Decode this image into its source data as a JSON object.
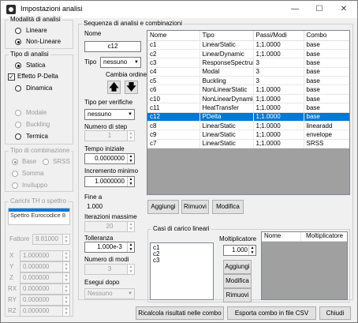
{
  "window": {
    "title": "Impostazioni analisi",
    "minimize": "—",
    "maximize": "☐",
    "close": "✕"
  },
  "modalita": {
    "title": "Modalità di analisi",
    "options": [
      "Lineare",
      "Non-Lineare"
    ]
  },
  "tipo_analisi": {
    "title": "Tipo di analisi",
    "statica": "Statica",
    "pdelta": "Effetto P-Delta",
    "dinamica": "Dinamica",
    "modale": "Modale",
    "buckling": "Buckling",
    "termica": "Termica"
  },
  "combinazione": {
    "title": "Tipo di combinazione",
    "base": "Base",
    "srss": "SRSS",
    "somma": "Somma",
    "inviluppo": "Inviluppo"
  },
  "carichi": {
    "title": "Carichi TH o spettro",
    "items": [
      "Spettro Eurocodice 8"
    ],
    "fattore_label": "Fattore",
    "fattore": "9.81000",
    "x_label": "X",
    "x": "1.000000",
    "y_label": "Y",
    "y": "0.000000",
    "z_label": "Z",
    "z": "0.000000",
    "rx_label": "RX",
    "rx": "0.000000",
    "ry_label": "RY",
    "ry": "0.000000",
    "rz_label": "RZ",
    "rz": "0.000000"
  },
  "sequenza": {
    "title": "Sequenza di analisi e combinazioni"
  },
  "form": {
    "nome_label": "Nome",
    "nome": "c12",
    "tipo_label": "Tipo",
    "tipo": "nessuno",
    "cambia_label": "Cambia ordine",
    "tipo_verifiche_label": "Tipo per verifiche",
    "tipo_verifiche": "nessuno",
    "step_label": "Numero di step",
    "step": "1",
    "tempo_label": "Tempo iniziale",
    "tempo": "0.0000000",
    "incremento_label": "Incremento minimo",
    "incremento": "1.0000000",
    "fine_label": "Fine a",
    "fine": "1.000",
    "iter_label": "Iterazioni massime",
    "iter": "20",
    "toll_label": "Tolleranza",
    "toll": "1.000e-3",
    "modi_label": "Numero di modi",
    "modi": "3",
    "dopo_label": "Esegui dopo",
    "dopo": "Nessuno"
  },
  "table": {
    "headers": [
      "Nome",
      "Tipo",
      "Passi/Modi",
      "Combo"
    ],
    "rows": [
      [
        "c1",
        "LinearStatic",
        "1;1.0000",
        "base"
      ],
      [
        "c2",
        "LinearDynamic",
        "1;1.0000",
        "base"
      ],
      [
        "c3",
        "ResponseSpectrum",
        "3",
        "base"
      ],
      [
        "c4",
        "Modal",
        "3",
        "base"
      ],
      [
        "c5",
        "Buckling",
        "3",
        "base"
      ],
      [
        "c6",
        "NonLinearStatic",
        "1;1.0000",
        "base"
      ],
      [
        "c10",
        "NonLinearDynamic",
        "1;1.0000",
        "base"
      ],
      [
        "c11",
        "HeatTransfer",
        "1;1.0000",
        "base"
      ],
      [
        "c12",
        "PDelta",
        "1;1.0000",
        "base"
      ],
      [
        "c8",
        "LinearStatic",
        "1;1.0000",
        "linearadd"
      ],
      [
        "c9",
        "LinearStatic",
        "1;1.0000",
        "envelope"
      ],
      [
        "c7",
        "LinearStatic",
        "1;1.0000",
        "SRSS"
      ]
    ],
    "selected": 8
  },
  "actions": {
    "aggiungi": "Aggiungi",
    "rimuovi": "Rimuovi",
    "modifica": "Modifica"
  },
  "casi": {
    "title": "Casi di carico lineari",
    "items": [
      "c1",
      "c2",
      "c3"
    ],
    "molt_label": "Moltiplicatore",
    "molt": "1.000",
    "aggiungi": "Aggiungi",
    "modifica": "Modifica",
    "rimuovi": "Rimuovi",
    "headers": [
      "Nome",
      "Moltiplicatore"
    ]
  },
  "footer": {
    "ricalcola": "Ricalcola risultati nelle combo",
    "esporta": "Esporta combo in file CSV",
    "chiudi": "Chiudi"
  }
}
